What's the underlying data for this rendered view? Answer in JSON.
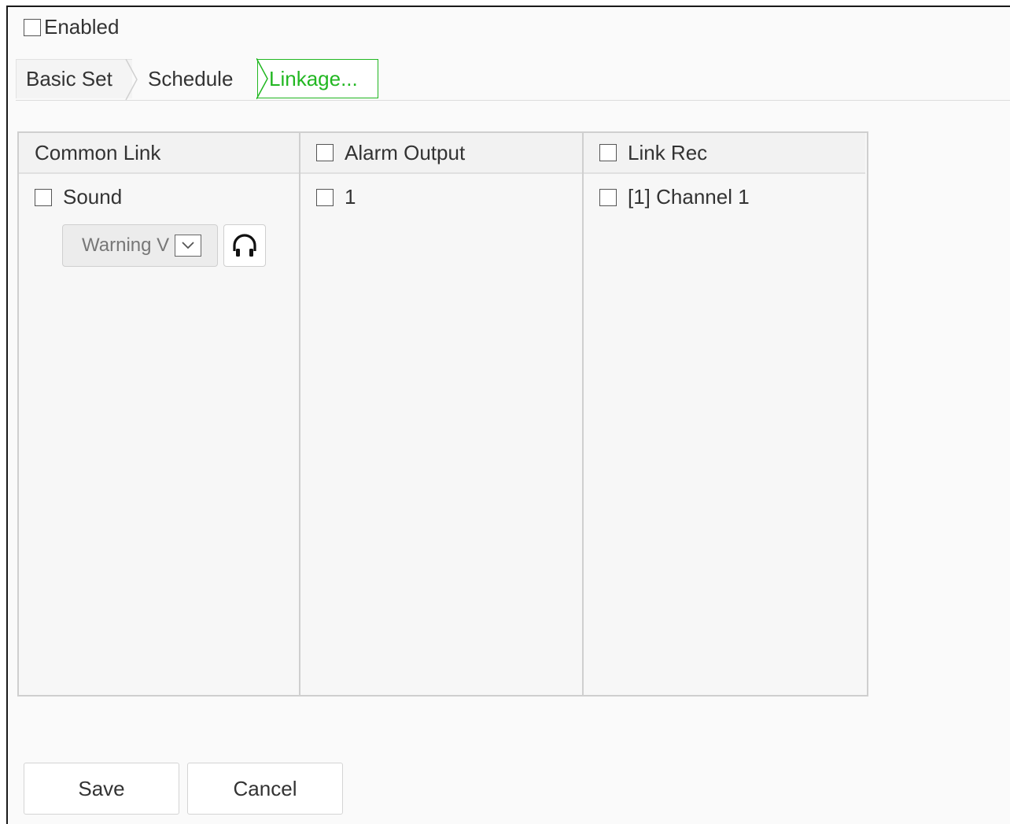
{
  "enabled": {
    "label": "Enabled",
    "checked": false
  },
  "tabs": [
    {
      "label": "Basic Set",
      "active": false
    },
    {
      "label": "Schedule",
      "active": false
    },
    {
      "label": "Linkage...",
      "active": true
    }
  ],
  "columns": {
    "common_link": {
      "header": "Common Link",
      "items": [
        {
          "label": "Sound",
          "checked": false
        }
      ],
      "sound_select": {
        "value": "Warning V",
        "icon": "chevron-down-icon"
      },
      "play_button": {
        "icon": "headphones-icon"
      }
    },
    "alarm_output": {
      "header": "Alarm Output",
      "header_checked": false,
      "items": [
        {
          "label": "1",
          "checked": false
        }
      ]
    },
    "link_rec": {
      "header": "Link Rec",
      "header_checked": false,
      "items": [
        {
          "label": "[1] Channel 1",
          "checked": false
        }
      ]
    }
  },
  "buttons": {
    "save": "Save",
    "cancel": "Cancel"
  },
  "colors": {
    "accent": "#22b722",
    "border": "#cfcfcf"
  }
}
